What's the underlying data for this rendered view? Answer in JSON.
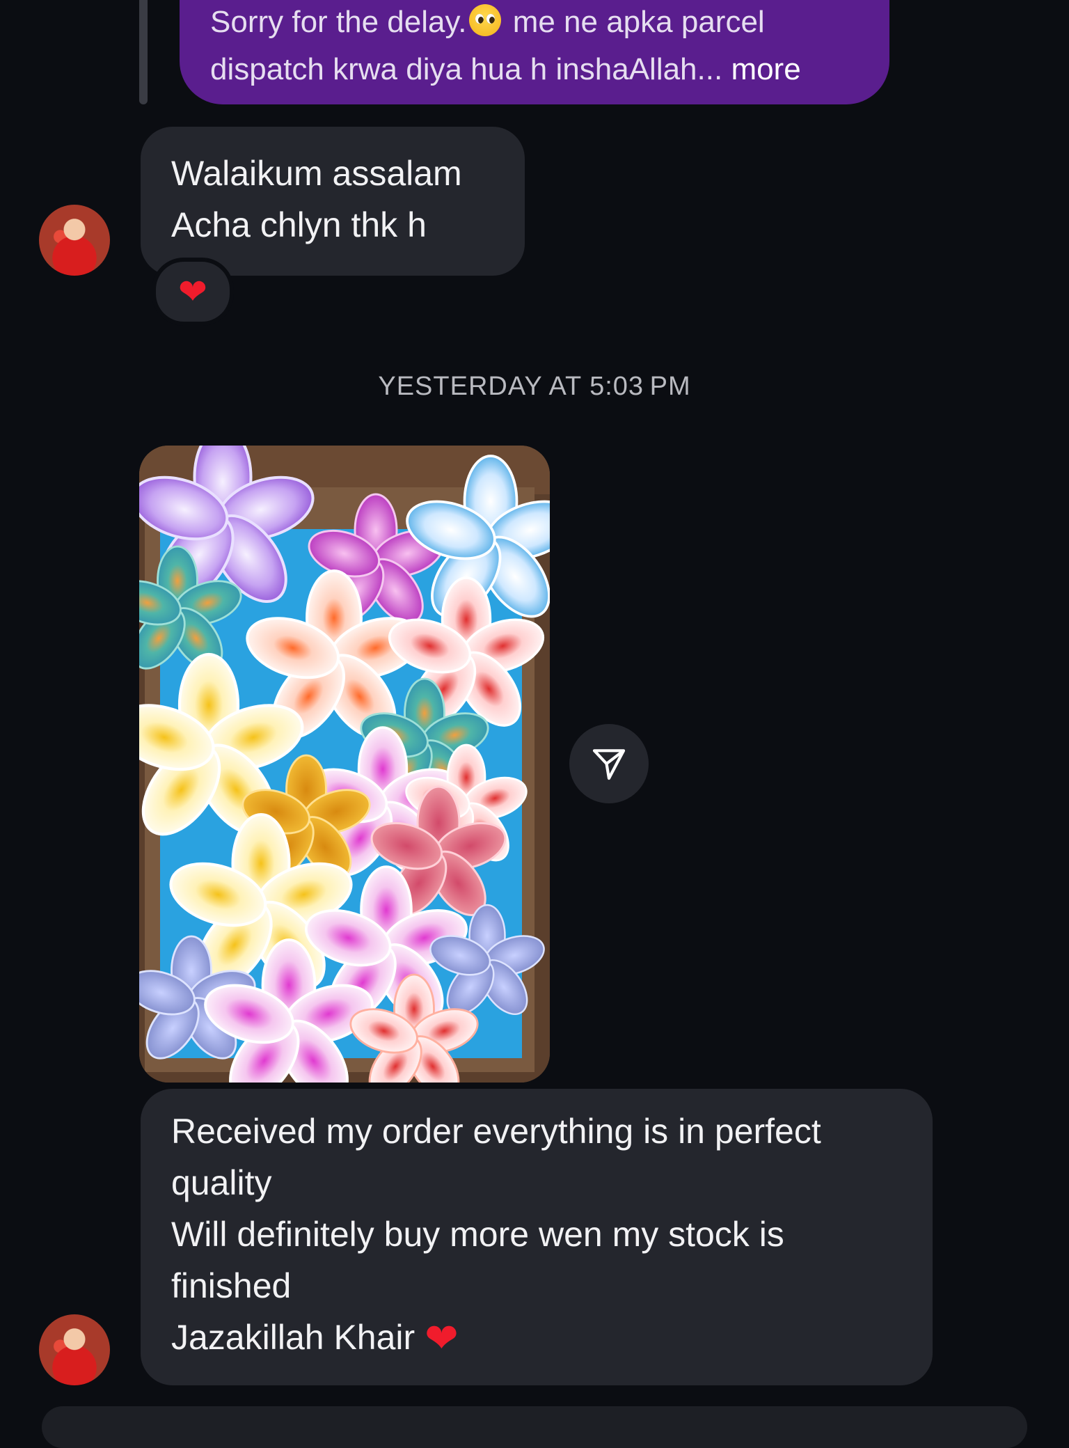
{
  "thread": {
    "sent_message": {
      "line1_before": "Sorry for the delay.",
      "line1_after": " me ne apka parcel",
      "line2_text": "dispatch krwa diya hua h inshaAllah... ",
      "more_label": "more"
    },
    "received_message_1": {
      "line1": "Walaikum assalam",
      "line2": "Acha chlyn thk h",
      "reaction": "❤"
    },
    "timestamp": "YESTERDAY AT 5:03 PM",
    "received_message_2": {
      "line1": "Received my order everything is in perfect",
      "line2": "quality",
      "line3": "Will definitely buy more wen my stock is",
      "line4": "finished",
      "line5": "Jazakillah Khair ",
      "heart": "❤"
    }
  },
  "colors": {
    "background": "#0b0d12",
    "sent_bubble": "#5a1e8e",
    "received_bubble": "#24262d",
    "heart": "#f01c2c",
    "timestamp_text": "#b9bac0"
  },
  "icons": {
    "emoji_in_sent": "pleading-face-emoji",
    "share": "send-paper-plane-icon",
    "reaction": "red-heart-emoji"
  }
}
